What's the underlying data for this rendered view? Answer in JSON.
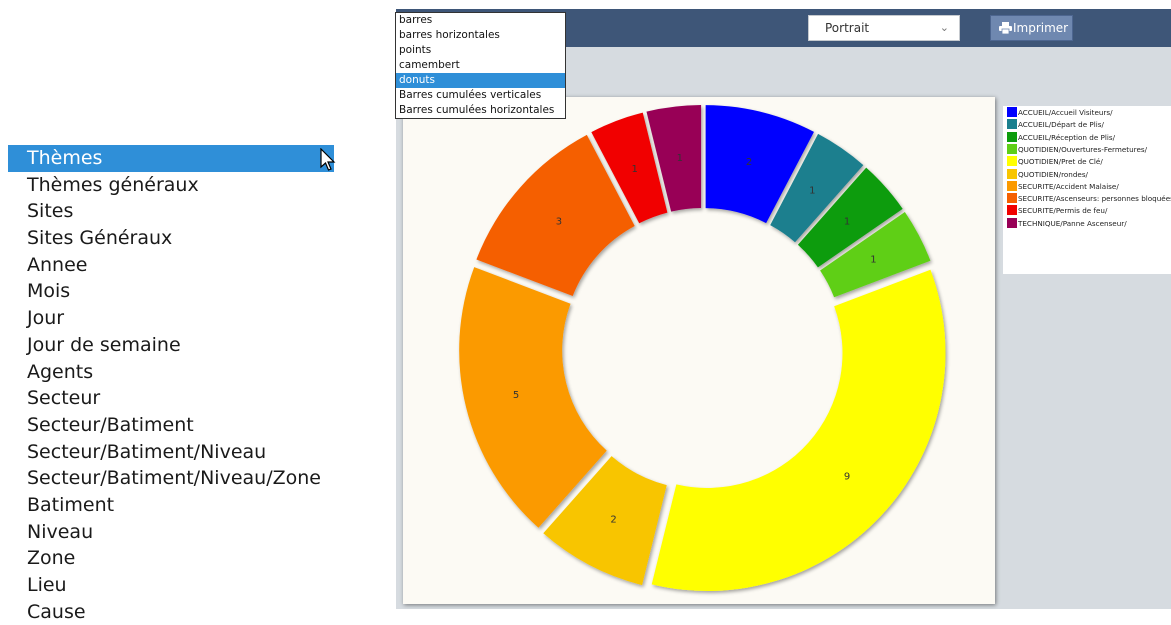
{
  "left_list": {
    "items": [
      {
        "label": "Thèmes",
        "selected": true
      },
      {
        "label": "Thèmes généraux"
      },
      {
        "label": "Sites"
      },
      {
        "label": "Sites Généraux"
      },
      {
        "label": "Annee"
      },
      {
        "label": "Mois"
      },
      {
        "label": "Jour"
      },
      {
        "label": "Jour de semaine"
      },
      {
        "label": "Agents"
      },
      {
        "label": "Secteur"
      },
      {
        "label": "Secteur/Batiment"
      },
      {
        "label": "Secteur/Batiment/Niveau"
      },
      {
        "label": "Secteur/Batiment/Niveau/Zone"
      },
      {
        "label": "Batiment"
      },
      {
        "label": "Niveau"
      },
      {
        "label": "Zone"
      },
      {
        "label": "Lieu"
      },
      {
        "label": "Cause"
      }
    ]
  },
  "toolbar": {
    "orientation_value": "Portrait",
    "print_label": "Imprimer"
  },
  "chart_type_dropdown": {
    "options": [
      "barres",
      "barres horizontales",
      "points",
      "camembert",
      "donuts",
      "Barres cumulées verticales",
      "Barres cumulées horizontales"
    ],
    "selected": "donuts"
  },
  "chart_data": {
    "type": "donut",
    "series": [
      {
        "name": "ACCUEIL/Accueil Visiteurs/",
        "value": 2,
        "color": "#0000ff"
      },
      {
        "name": "ACCUEIL/Départ de Plis/",
        "value": 1,
        "color": "#1a7f8e"
      },
      {
        "name": "ACCUEIL/Réception de Plis/",
        "value": 1,
        "color": "#0c9c0c"
      },
      {
        "name": "QUOTIDIEN/Ouvertures-Fermetures/",
        "value": 1,
        "color": "#5fcf17"
      },
      {
        "name": "QUOTIDIEN/Pret de Clé/",
        "value": 9,
        "color": "#ffff00"
      },
      {
        "name": "QUOTIDIEN/rondes/",
        "value": 2,
        "color": "#f8c500"
      },
      {
        "name": "SECURITE/Accident Malaise/",
        "value": 5,
        "color": "#fb9a00"
      },
      {
        "name": "SECURITE/Ascenseurs: personnes bloquées/",
        "value": 3,
        "color": "#f55f00"
      },
      {
        "name": "SECURITE/Permis de feu/",
        "value": 1,
        "color": "#f10000"
      },
      {
        "name": "TECHNIQUE/Panne Ascenseur/",
        "value": 1,
        "color": "#980057"
      }
    ]
  }
}
